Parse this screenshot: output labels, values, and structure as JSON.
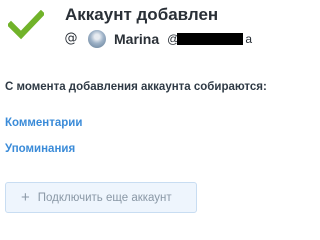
{
  "header": {
    "title": "Аккаунт добавлен",
    "status_icon": "check-icon",
    "status_color": "#71b32a"
  },
  "account": {
    "platform_icon": "threads-icon",
    "platform_glyph": "@",
    "username": "Marina",
    "handle_prefix": "@",
    "handle_suffix": "a"
  },
  "info": {
    "subtitle": "С момента добавления аккаунта собираются:",
    "items": [
      "Комментарии",
      "Упоминания"
    ]
  },
  "actions": {
    "add_account_label": "Подключить еще аккаунт",
    "add_icon": "plus-icon",
    "add_glyph": "+"
  },
  "colors": {
    "link": "#3a8bd8",
    "button_bg": "#eef5fd",
    "button_border": "#c8ddf2"
  }
}
